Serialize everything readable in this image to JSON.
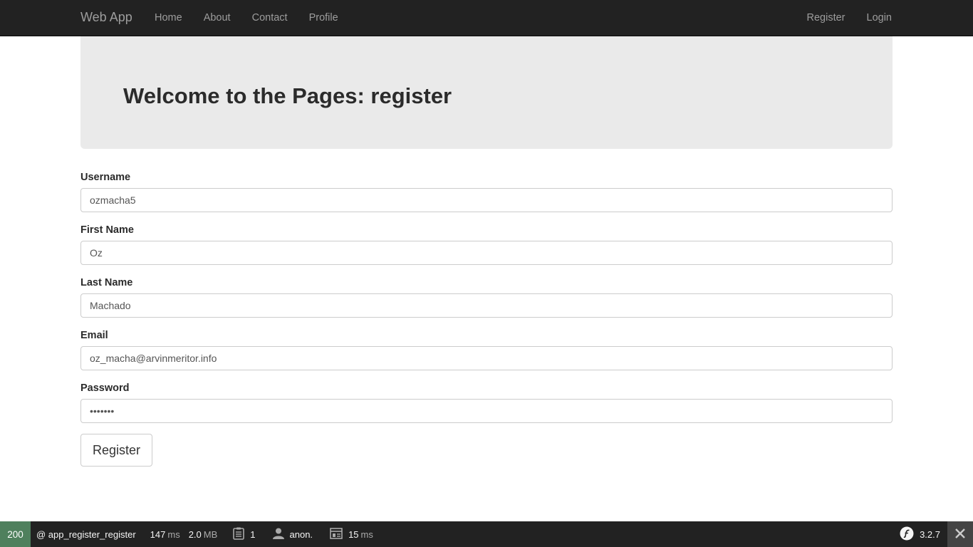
{
  "navbar": {
    "brand": "Web App",
    "left_links": [
      "Home",
      "About",
      "Contact",
      "Profile"
    ],
    "right_links": [
      "Register",
      "Login"
    ]
  },
  "jumbotron": {
    "title": "Welcome to the Pages: register"
  },
  "form": {
    "username": {
      "label": "Username",
      "value": "ozmacha5"
    },
    "first_name": {
      "label": "First Name",
      "value": "Oz"
    },
    "last_name": {
      "label": "Last Name",
      "value": "Machado"
    },
    "email": {
      "label": "Email",
      "value": "oz_macha@arvinmeritor.info"
    },
    "password": {
      "label": "Password",
      "value": "•••••••"
    },
    "submit_label": "Register"
  },
  "debug_toolbar": {
    "status_code": "200",
    "route": "@ app_register_register",
    "time": "147",
    "time_unit": "ms",
    "memory": "2.0",
    "memory_unit": "MB",
    "logs_count": "1",
    "user": "anon.",
    "render_time": "15",
    "render_unit": "ms",
    "version": "3.2.7",
    "colors": {
      "status_bg": "#4f805d",
      "bar_bg": "#222222"
    },
    "icons": [
      "clipboard-icon",
      "user-icon",
      "layout-icon",
      "symfony-logo-icon",
      "close-icon"
    ]
  }
}
